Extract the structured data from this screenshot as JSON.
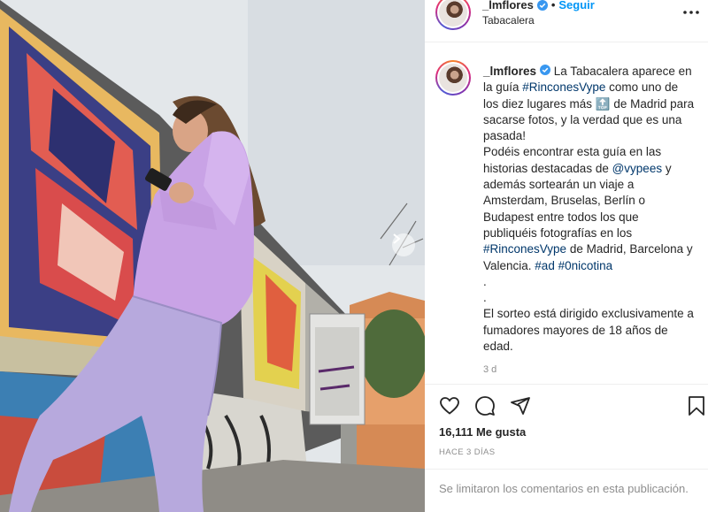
{
  "header": {
    "username": "_lmflores",
    "separator": "•",
    "follow_label": "Seguir",
    "location": "Tabacalera"
  },
  "caption": {
    "username": "_lmflores",
    "p1a": " La Tabacalera aparece en la guía ",
    "hashtag1": "#RinconesVype",
    "p1b": " como uno de los diez lugares más ",
    "emoji": "🔝",
    "p1c": " de Madrid para sacarse fotos, y la verdad que es una pasada!",
    "p2a": "Podéis encontrar esta guía en las historias destacadas de ",
    "mention": "@vypees",
    "p2b": " y además sortearán un viaje a Amsterdam, Bruselas, Berlín o Budapest entre todos los que publiquéis fotografías en los ",
    "hashtag2": "#RinconesVype",
    "p2c": " de Madrid, Barcelona y Valencia. ",
    "hashtag3": "#ad",
    "hashtag4": "#0nicotina",
    "dot1": ".",
    "dot2": ".",
    "p3": "El sorteo está dirigido exclusivamente a fumadores mayores de 18 años de edad.",
    "time_ago": "3 d"
  },
  "actions": {
    "like_icon": "heart-icon",
    "comment_icon": "comment-icon",
    "share_icon": "paper-plane-icon",
    "save_icon": "bookmark-icon"
  },
  "stats": {
    "likes": "16,111 Me gusta",
    "posted": "HACE 3 DÍAS"
  },
  "comments_notice": "Se limitaron los comentarios en esta publicación.",
  "colors": {
    "link": "#0095f6",
    "hashtag": "#00376b",
    "verified": "#3897f0",
    "muted": "#8e8e8e",
    "jacket": "#c9a3e6",
    "pants": "#b7a9dd"
  }
}
